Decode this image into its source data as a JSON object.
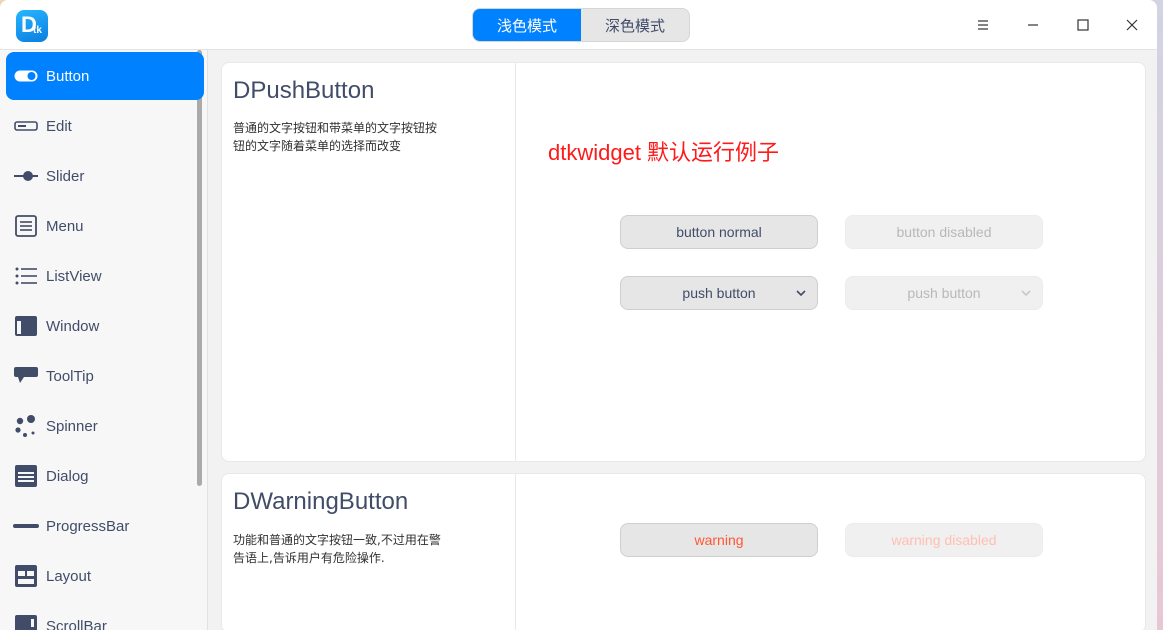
{
  "app": {
    "logo_letter": "D",
    "logo_sub": "tk"
  },
  "titlebar": {
    "modes": [
      "浅色模式",
      "深色模式"
    ],
    "active_mode": "浅色模式"
  },
  "sidebar": {
    "items": [
      {
        "label": "Button",
        "icon": "toggle-icon"
      },
      {
        "label": "Edit",
        "icon": "edit-field-icon"
      },
      {
        "label": "Slider",
        "icon": "slider-icon"
      },
      {
        "label": "Menu",
        "icon": "menu-icon"
      },
      {
        "label": "ListView",
        "icon": "list-icon"
      },
      {
        "label": "Window",
        "icon": "window-icon"
      },
      {
        "label": "ToolTip",
        "icon": "tooltip-icon"
      },
      {
        "label": "Spinner",
        "icon": "spinner-icon"
      },
      {
        "label": "Dialog",
        "icon": "dialog-icon"
      },
      {
        "label": "ProgressBar",
        "icon": "progressbar-icon"
      },
      {
        "label": "Layout",
        "icon": "layout-icon"
      },
      {
        "label": "ScrollBar",
        "icon": "scrollbar-icon"
      }
    ],
    "active": "Button"
  },
  "cards": {
    "push": {
      "title": "DPushButton",
      "desc": "普通的文字按钮和带菜单的文字按钮按钮的文字随着菜单的选择而改变",
      "banner": "dtkwidget 默认运行例子",
      "buttons": {
        "normal": "button normal",
        "disabled": "button disabled",
        "push": "push button",
        "push_disabled": "push button"
      }
    },
    "warning": {
      "title": "DWarningButton",
      "desc": "功能和普通的文字按钮一致,不过用在警告语上,告诉用户有危险操作.",
      "buttons": {
        "warning": "warning",
        "warning_disabled": "warning disabled"
      }
    }
  },
  "colors": {
    "accent": "#0081ff",
    "text": "#414d68",
    "banner": "#ff1a1a",
    "warning": "#ff5736"
  }
}
